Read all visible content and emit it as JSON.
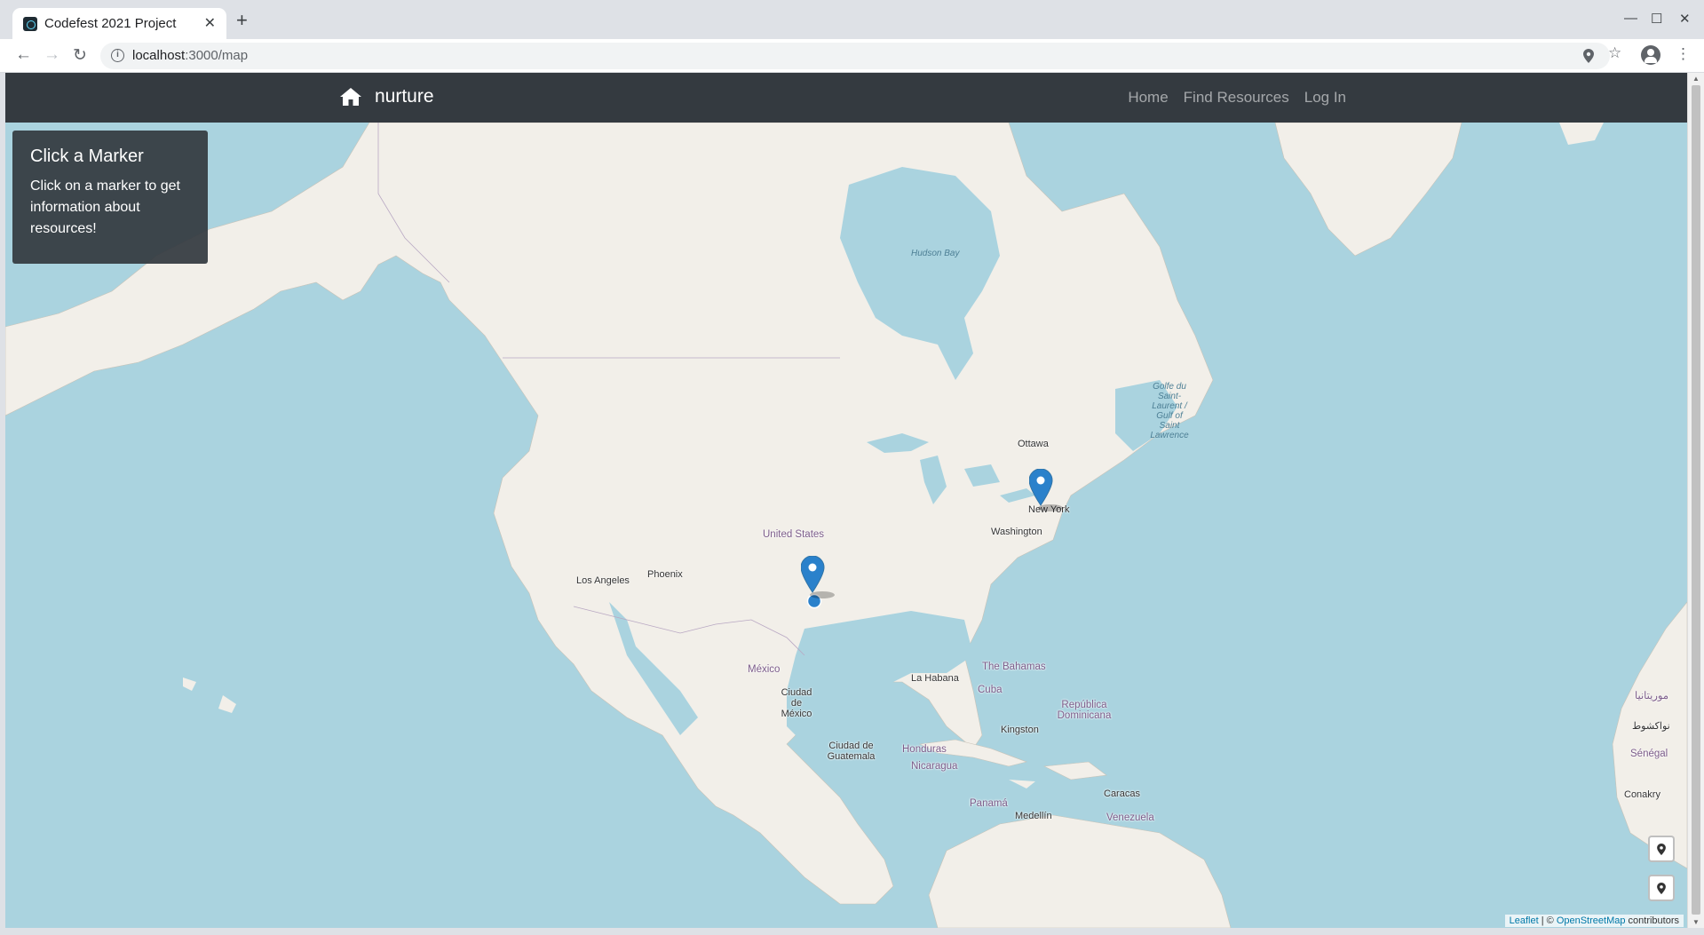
{
  "browser": {
    "tab_title": "Codefest 2021 Project",
    "tab_close": "✕",
    "new_tab": "+",
    "url_host": "localhost",
    "url_path": ":3000/map",
    "back": "←",
    "forward": "→",
    "reload": "↻",
    "minimize": "—",
    "maximize": "☐",
    "close": "✕",
    "menu": "⋮",
    "bookmark": "☆"
  },
  "navbar": {
    "brand": "nurture",
    "links": [
      "Home",
      "Find Resources",
      "Log In"
    ]
  },
  "info_panel": {
    "title": "Click a Marker",
    "text": "Click on a marker to get information about resources!"
  },
  "map_labels": {
    "hudson_bay": "Hudson Bay",
    "golfe": "Golfe du Saint-Laurent / Gulf of Saint Lawrence",
    "ottawa": "Ottawa",
    "new_york": "New York",
    "washington": "Washington",
    "united_states": "United States",
    "phoenix": "Phoenix",
    "los_angeles": "Los Angeles",
    "mexico": "México",
    "ciudad_mexico": "Ciudad de México",
    "la_habana": "La Habana",
    "the_bahamas": "The Bahamas",
    "cuba": "Cuba",
    "republica_dominicana": "República Dominicana",
    "kingston": "Kingston",
    "ciudad_guatemala": "Ciudad de Guatemala",
    "honduras": "Honduras",
    "nicaragua": "Nicaragua",
    "panama": "Panamá",
    "caracas": "Caracas",
    "medellin": "Medellín",
    "venezuela": "Venezuela",
    "senegal": "Sénégal",
    "conakry": "Conakry",
    "nouakchott": "نواكشوط",
    "mauritania": "موريتانيا"
  },
  "attribution": {
    "leaflet": "Leaflet",
    "separator": " | © ",
    "osm": "OpenStreetMap",
    "contributors": " contributors"
  },
  "colors": {
    "navbar": "#343a40",
    "water": "#aad3df",
    "land": "#f2efe9",
    "marker": "#2a81cb"
  }
}
